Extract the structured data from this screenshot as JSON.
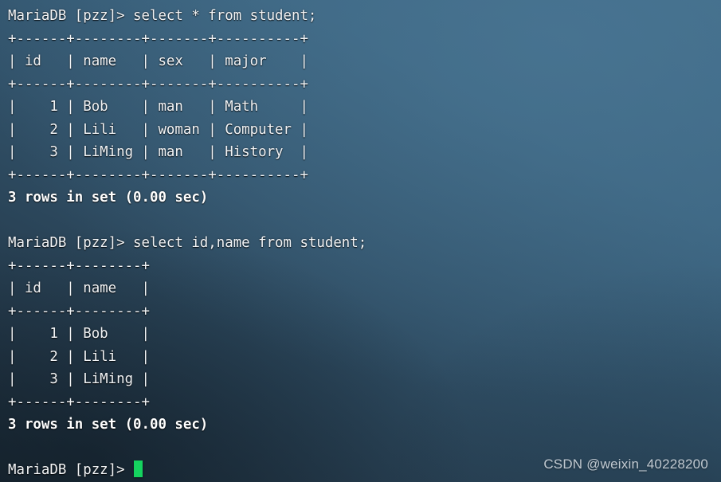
{
  "terminal": {
    "app": "MariaDB client",
    "prompt": "MariaDB [pzz]> ",
    "cursor_color": "#15d35f",
    "text_color": "#f2f4f6",
    "background_colors": {
      "dark": "#1b2a36",
      "mid": "#32536b",
      "light": "#3f6a87"
    }
  },
  "lines": [
    {
      "text": "MariaDB [pzz]> select * from student;",
      "bold": false
    },
    {
      "text": "+------+--------+-------+----------+",
      "bold": false
    },
    {
      "text": "| id   | name   | sex   | major    |",
      "bold": false
    },
    {
      "text": "+------+--------+-------+----------+",
      "bold": false
    },
    {
      "text": "|    1 | Bob    | man   | Math     |",
      "bold": false
    },
    {
      "text": "|    2 | Lili   | woman | Computer |",
      "bold": false
    },
    {
      "text": "|    3 | LiMing | man   | History  |",
      "bold": false
    },
    {
      "text": "+------+--------+-------+----------+",
      "bold": false
    },
    {
      "text": "3 rows in set (0.00 sec)",
      "bold": true
    },
    {
      "text": "",
      "bold": false
    },
    {
      "text": "MariaDB [pzz]> select id,name from student;",
      "bold": false
    },
    {
      "text": "+------+--------+",
      "bold": false
    },
    {
      "text": "| id   | name   |",
      "bold": false
    },
    {
      "text": "+------+--------+",
      "bold": false
    },
    {
      "text": "|    1 | Bob    |",
      "bold": false
    },
    {
      "text": "|    2 | Lili   |",
      "bold": false
    },
    {
      "text": "|    3 | LiMing |",
      "bold": false
    },
    {
      "text": "+------+--------+",
      "bold": false
    },
    {
      "text": "3 rows in set (0.00 sec)",
      "bold": true
    },
    {
      "text": "",
      "bold": false
    }
  ],
  "final_prompt": "MariaDB [pzz]> ",
  "watermark": "CSDN @weixin_40228200",
  "queries": [
    {
      "sql": "select * from student;",
      "columns": [
        "id",
        "name",
        "sex",
        "major"
      ],
      "rows": [
        [
          "1",
          "Bob",
          "man",
          "Math"
        ],
        [
          "2",
          "Lili",
          "woman",
          "Computer"
        ],
        [
          "3",
          "LiMing",
          "man",
          "History"
        ]
      ],
      "result_status": "3 rows in set (0.00 sec)"
    },
    {
      "sql": "select id,name from student;",
      "columns": [
        "id",
        "name"
      ],
      "rows": [
        [
          "1",
          "Bob"
        ],
        [
          "2",
          "Lili"
        ],
        [
          "3",
          "LiMing"
        ]
      ],
      "result_status": "3 rows in set (0.00 sec)"
    }
  ]
}
